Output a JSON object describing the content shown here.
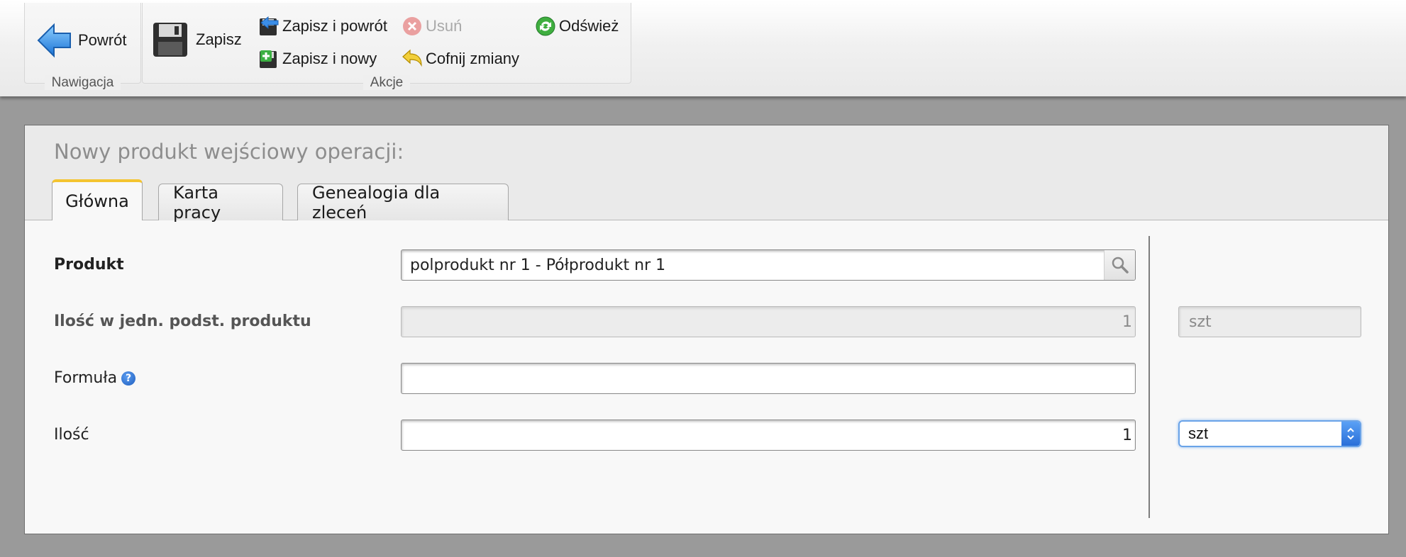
{
  "toolbar": {
    "navigation_group": {
      "label": "Nawigacja",
      "back_label": "Powrót"
    },
    "actions_group": {
      "label": "Akcje",
      "save_label": "Zapisz",
      "save_and_back_label": "Zapisz i powrót",
      "save_and_new_label": "Zapisz i nowy",
      "delete_label": "Usuń",
      "undo_label": "Cofnij zmiany",
      "refresh_label": "Odśwież"
    }
  },
  "form": {
    "title": "Nowy produkt wejściowy operacji:",
    "tabs": [
      {
        "label": "Główna",
        "active": true
      },
      {
        "label": "Karta pracy",
        "active": false
      },
      {
        "label": "Genealogia dla zleceń",
        "active": false
      }
    ],
    "fields": {
      "product": {
        "label": "Produkt",
        "value": "polprodukt nr 1 - Półprodukt nr 1"
      },
      "qty_base": {
        "label": "Ilość w jedn. podst. produktu",
        "value": "1",
        "unit": "szt"
      },
      "formula": {
        "label": "Formuła",
        "value": ""
      },
      "qty": {
        "label": "Ilość",
        "value": "1",
        "unit": "szt"
      }
    }
  },
  "colors": {
    "active_tab_accent": "#f4c430",
    "select_focus": "#6aa3e8",
    "page_background": "#9a9a9a"
  }
}
